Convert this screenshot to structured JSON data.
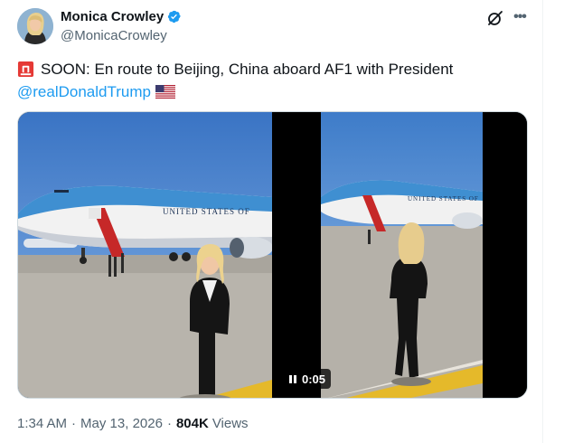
{
  "author": {
    "display_name": "Monica Crowley",
    "handle": "@MonicaCrowley"
  },
  "tweet": {
    "text": "SOON: En route to Beijing, China aboard AF1 with President",
    "mention": "@realDonaldTrump",
    "leading_emoji": "police-car-light",
    "trailing_emoji": "us-flag"
  },
  "media": {
    "photo_plane_livery": "UNITED STATES OF",
    "video_plane_livery": "UNITED STATES OF",
    "video_duration": "0:05"
  },
  "footer": {
    "time": "1:34 AM",
    "separator": "·",
    "date": "May 13, 2026",
    "views_count": "804K",
    "views_label": "Views"
  },
  "colors": {
    "link": "#1d9bf0",
    "secondary_text": "#536471",
    "primary_text": "#0f1419",
    "verified": "#1d9bf0"
  },
  "icons": [
    "verified-badge-icon",
    "grok-icon",
    "more-icon",
    "siren-icon",
    "us-flag-icon",
    "pause-icon"
  ]
}
